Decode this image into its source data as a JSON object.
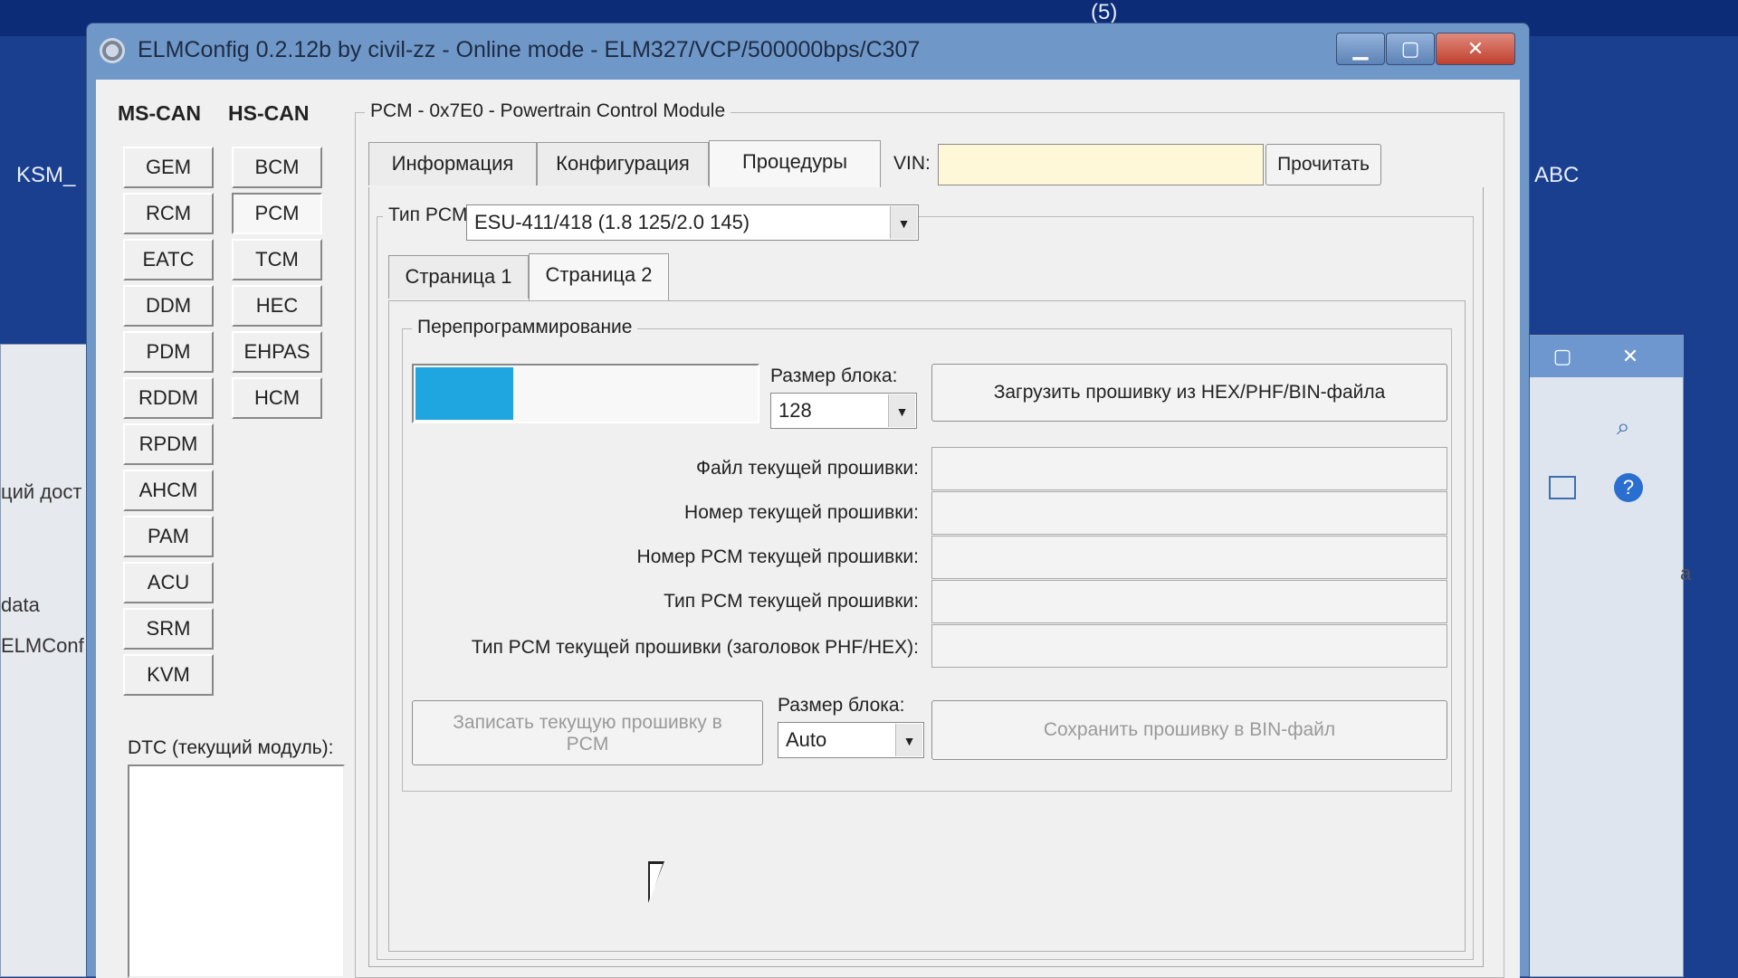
{
  "window": {
    "title": "ELMConfig 0.2.12b by civil-zz - Online mode - ELM327/VCP/500000bps/C307"
  },
  "titlebar_buttons": {
    "minimize": "▁",
    "maximize": "▢",
    "close": "✕"
  },
  "desktop": {
    "counter": "(5)",
    "icon_label": "KSM_",
    "bg_labels": [
      "ций дост",
      "data",
      "ELMConf"
    ],
    "right_label": "ABC",
    "right_side_label": "a"
  },
  "bus_tabs": {
    "ms_can": "MS-CAN",
    "hs_can": "HS-CAN"
  },
  "ms_can_modules": [
    "GEM",
    "RCM",
    "EATC",
    "DDM",
    "PDM",
    "RDDM",
    "RPDM",
    "AHCM",
    "PAM",
    "ACU",
    "SRM",
    "KVM"
  ],
  "hs_can_modules": [
    "BCM",
    "PCM",
    "TCM",
    "HEC",
    "EHPAS",
    "HCM"
  ],
  "active_module": "PCM",
  "dtc": {
    "label": "DTC (текущий модуль):"
  },
  "module_panel": {
    "title": "PCM - 0x7E0 - Powertrain Control Module",
    "tabs": [
      "Информация",
      "Конфигурация",
      "Процедуры"
    ],
    "active_tab": "Процедуры",
    "vin_label": "VIN:",
    "vin_value": "",
    "read_button": "Прочитать",
    "pcm_type_label": "Тип PCM:",
    "pcm_type_value": "ESU-411/418 (1.8 125/2.0 145)",
    "pages": [
      "Страница 1",
      "Страница 2"
    ],
    "active_page": "Страница 2"
  },
  "reprogramming": {
    "title": "Перепрограммирование",
    "progress_fraction": 0.29,
    "block_size_label": "Размер блока:",
    "block_size_value": "128",
    "load_button": "Загрузить прошивку из HEX/PHF/BIN-файла",
    "fields": [
      {
        "label": "Файл текущей прошивки:",
        "value": ""
      },
      {
        "label": "Номер текущей прошивки:",
        "value": ""
      },
      {
        "label": "Номер PCM текущей прошивки:",
        "value": ""
      },
      {
        "label": "Тип PCM текущей прошивки:",
        "value": ""
      },
      {
        "label": "Тип PCM текущей прошивки (заголовок PHF/HEX):",
        "value": ""
      }
    ],
    "write_button": "Записать текущую прошивку в PCM",
    "block_size2_label": "Размер блока:",
    "block_size2_value": "Auto",
    "save_button": "Сохранить прошивку в BIN-файл"
  },
  "colors": {
    "progress": "#1fa5e0",
    "vin_bg": "#fff8d8",
    "titlebar": "#6f98c8"
  }
}
